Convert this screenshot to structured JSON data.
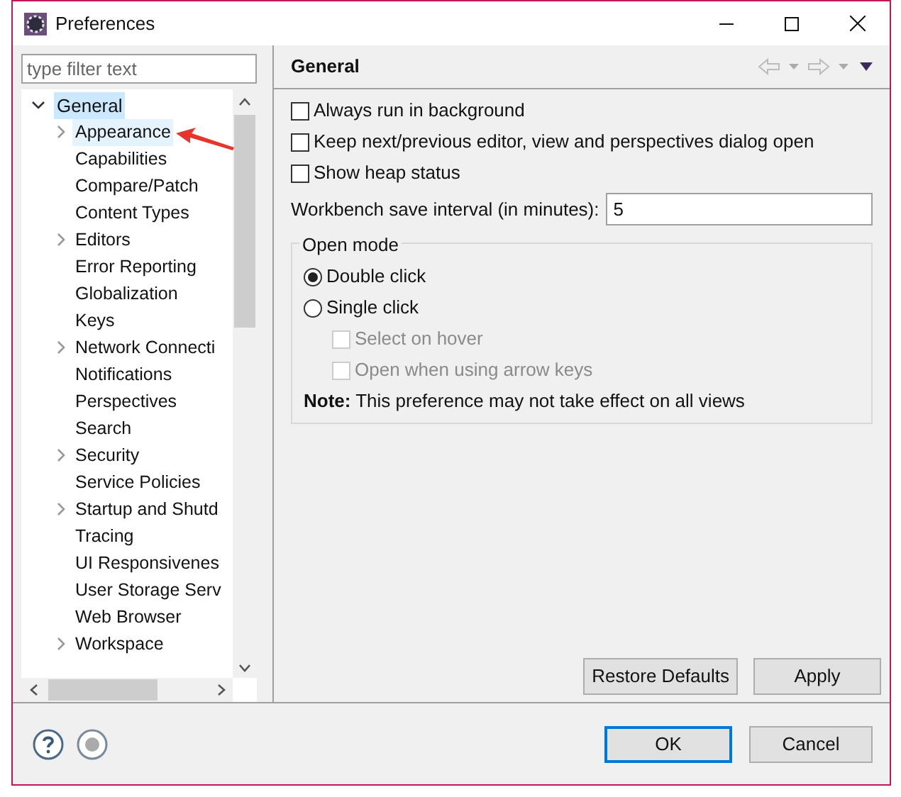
{
  "window": {
    "title": "Preferences"
  },
  "filter": {
    "placeholder": "type filter text"
  },
  "tree": [
    {
      "label": "General",
      "expanded": true,
      "selected": true,
      "children": [
        {
          "label": "Appearance",
          "expandable": true,
          "selected": false,
          "hovered": true
        },
        {
          "label": "Capabilities",
          "expandable": false,
          "selected": false,
          "hovered": false
        },
        {
          "label": "Compare/Patch",
          "expandable": false,
          "selected": false,
          "hovered": false
        },
        {
          "label": "Content Types",
          "expandable": false,
          "selected": false,
          "hovered": false
        },
        {
          "label": "Editors",
          "expandable": true,
          "selected": false,
          "hovered": false
        },
        {
          "label": "Error Reporting",
          "expandable": false,
          "selected": false,
          "hovered": false
        },
        {
          "label": "Globalization",
          "expandable": false,
          "selected": false,
          "hovered": false
        },
        {
          "label": "Keys",
          "expandable": false,
          "selected": false,
          "hovered": false
        },
        {
          "label": "Network Connecti",
          "expandable": true,
          "selected": false,
          "hovered": false
        },
        {
          "label": "Notifications",
          "expandable": false,
          "selected": false,
          "hovered": false
        },
        {
          "label": "Perspectives",
          "expandable": false,
          "selected": false,
          "hovered": false
        },
        {
          "label": "Search",
          "expandable": false,
          "selected": false,
          "hovered": false
        },
        {
          "label": "Security",
          "expandable": true,
          "selected": false,
          "hovered": false
        },
        {
          "label": "Service Policies",
          "expandable": false,
          "selected": false,
          "hovered": false
        },
        {
          "label": "Startup and Shutd",
          "expandable": true,
          "selected": false,
          "hovered": false
        },
        {
          "label": "Tracing",
          "expandable": false,
          "selected": false,
          "hovered": false
        },
        {
          "label": "UI Responsivenes",
          "expandable": false,
          "selected": false,
          "hovered": false
        },
        {
          "label": "User Storage Serv",
          "expandable": false,
          "selected": false,
          "hovered": false
        },
        {
          "label": "Web Browser",
          "expandable": false,
          "selected": false,
          "hovered": false
        },
        {
          "label": "Workspace",
          "expandable": true,
          "selected": false,
          "hovered": false
        }
      ]
    }
  ],
  "page": {
    "title": "General",
    "options": [
      {
        "label": "Always run in background",
        "checked": false
      },
      {
        "label": "Keep next/previous editor, view and perspectives dialog open",
        "checked": false
      },
      {
        "label": "Show heap status",
        "checked": false
      }
    ],
    "save_interval": {
      "label": "Workbench save interval (in minutes):",
      "value": "5"
    },
    "open_mode": {
      "title": "Open mode",
      "radios": [
        {
          "label": "Double click",
          "selected": true
        },
        {
          "label": "Single click",
          "selected": false
        }
      ],
      "sub_options": [
        {
          "label": "Select on hover",
          "checked": false,
          "disabled": true
        },
        {
          "label": "Open when using arrow keys",
          "checked": false,
          "disabled": true
        }
      ],
      "note": "**Note:** This preference may not take effect on all views"
    },
    "buttons": [
      "Restore Defaults",
      "Apply"
    ]
  },
  "footer_buttons": [
    {
      "label": "OK",
      "default": true
    },
    {
      "label": "Cancel",
      "default": false
    }
  ]
}
